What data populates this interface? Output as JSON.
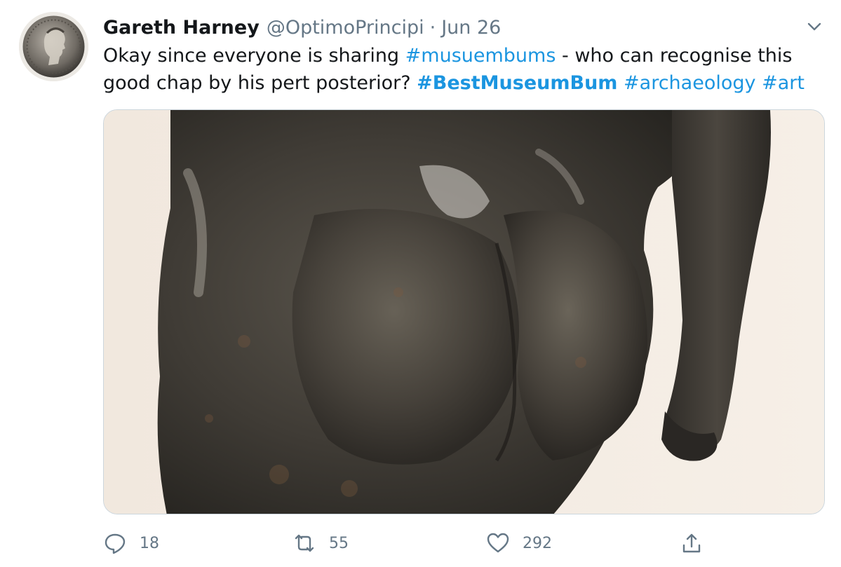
{
  "tweet": {
    "display_name": "Gareth Harney",
    "handle": "@OptimoPrincipi",
    "separator": "·",
    "date": "Jun 26",
    "text": {
      "line1_prefix": "Okay since everyone is sharing ",
      "hashtag_musuembums": "#musuembums",
      "line1_suffix": " - who can recognise this",
      "line2_prefix": "good chap by his pert posterior? ",
      "hashtag_bestmuseumbum": "#BestMuseumBum",
      "space1": " ",
      "hashtag_archaeology": "#archaeology",
      "space2": " ",
      "hashtag_art": "#art"
    },
    "actions": {
      "reply_count": "18",
      "retweet_count": "55",
      "like_count": "292"
    }
  },
  "colors": {
    "hashtag": "#1b95e0",
    "muted": "#657786",
    "text": "#14171a"
  },
  "icons": {
    "avatar": "roman-coin-avatar",
    "caret": "chevron-down-icon",
    "reply": "reply-icon",
    "retweet": "retweet-icon",
    "like": "heart-icon",
    "share": "share-icon"
  }
}
